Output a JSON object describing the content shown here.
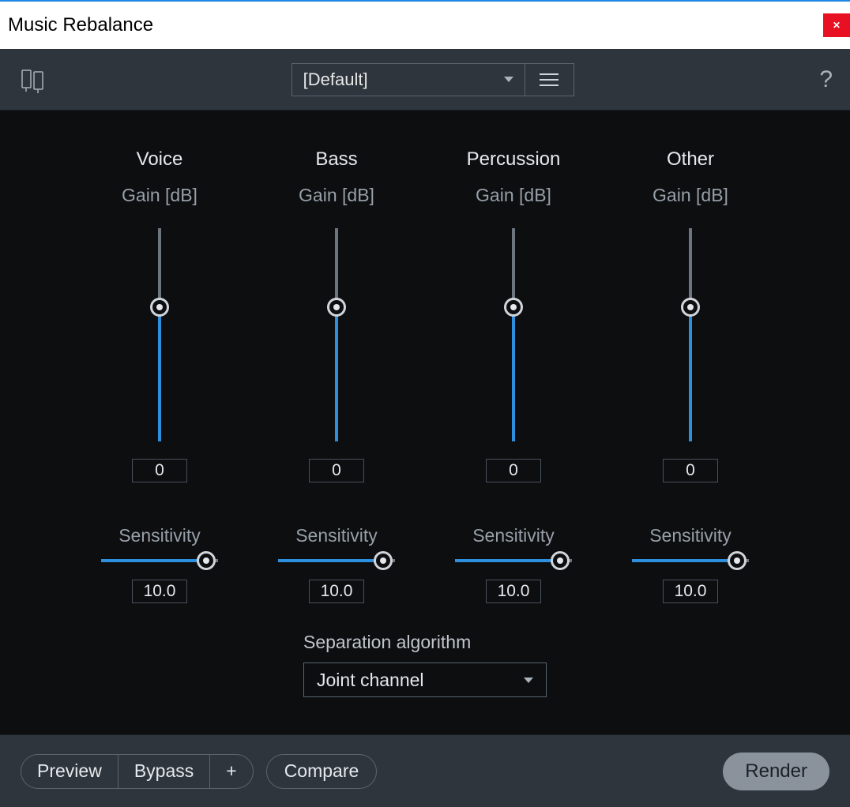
{
  "window": {
    "title": "Music Rebalance"
  },
  "toolbar": {
    "preset": "[Default]"
  },
  "gain_unit_label": "Gain [dB]",
  "sensitivity_label": "Sensitivity",
  "channels": [
    {
      "name": "Voice",
      "gain": "0",
      "gain_pct": 37,
      "sensitivity": "10.0",
      "sens_pct": 90
    },
    {
      "name": "Bass",
      "gain": "0",
      "gain_pct": 37,
      "sensitivity": "10.0",
      "sens_pct": 90
    },
    {
      "name": "Percussion",
      "gain": "0",
      "gain_pct": 37,
      "sensitivity": "10.0",
      "sens_pct": 90
    },
    {
      "name": "Other",
      "gain": "0",
      "gain_pct": 37,
      "sensitivity": "10.0",
      "sens_pct": 90
    }
  ],
  "separation": {
    "label": "Separation algorithm",
    "value": "Joint channel"
  },
  "footer": {
    "preview": "Preview",
    "bypass": "Bypass",
    "plus": "+",
    "compare": "Compare",
    "render": "Render"
  }
}
